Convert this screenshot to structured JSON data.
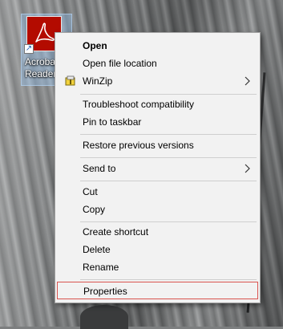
{
  "desktop": {
    "shortcut_label": "Acrobat Reader DC",
    "shortcut_label_visible": "Acroba\nReader I"
  },
  "menu": {
    "items": [
      {
        "label": "Open",
        "bold": true
      },
      {
        "label": "Open file location"
      },
      {
        "label": "WinZip",
        "icon": "winzip-icon",
        "submenu": true
      },
      {
        "label": "Troubleshoot compatibility"
      },
      {
        "label": "Pin to taskbar"
      },
      {
        "label": "Restore previous versions"
      },
      {
        "label": "Send to",
        "submenu": true
      },
      {
        "label": "Cut"
      },
      {
        "label": "Copy"
      },
      {
        "label": "Create shortcut"
      },
      {
        "label": "Delete"
      },
      {
        "label": "Rename"
      },
      {
        "label": "Properties",
        "highlighted": true
      }
    ]
  },
  "colors": {
    "menu_bg": "#f2f2f2",
    "highlight_border": "#d9534f",
    "acrobat_red": "#b30b00"
  }
}
